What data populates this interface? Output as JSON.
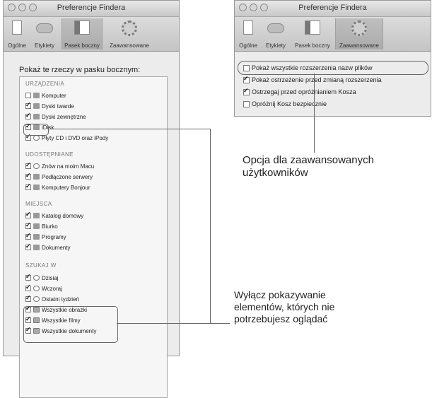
{
  "left_window": {
    "title": "Preferencje Findera",
    "toolbar": [
      "Ogólne",
      "Etykiety",
      "Pasek boczny",
      "Zaawansowane"
    ],
    "selected_tab": "Pasek boczny",
    "heading": "Pokaż te rzeczy w pasku bocznym:",
    "sections": [
      {
        "name": "URZĄDZENIA",
        "items": [
          {
            "label": "Komputer",
            "checked": false
          },
          {
            "label": "Dyski twarde",
            "checked": true
          },
          {
            "label": "Dyski zewnętrzne",
            "checked": true
          },
          {
            "label": "iDisk",
            "checked": true
          },
          {
            "label": "Płyty CD i DVD oraz iPody",
            "checked": true
          }
        ]
      },
      {
        "name": "UDOSTĘPNIANE",
        "items": [
          {
            "label": "Znów na moim Macu",
            "checked": true
          },
          {
            "label": "Podłączone serwery",
            "checked": true
          },
          {
            "label": "Komputery Bonjour",
            "checked": true
          }
        ]
      },
      {
        "name": "MIEJSCA",
        "items": [
          {
            "label": "Katalog domowy",
            "checked": true
          },
          {
            "label": "Biurko",
            "checked": true
          },
          {
            "label": "Programy",
            "checked": true
          },
          {
            "label": "Dokumenty",
            "checked": true
          }
        ]
      },
      {
        "name": "SZUKAJ W",
        "items": [
          {
            "label": "Dzisiaj",
            "checked": true
          },
          {
            "label": "Wczoraj",
            "checked": true
          },
          {
            "label": "Ostatni tydzień",
            "checked": true
          },
          {
            "label": "Wszystkie obrazki",
            "checked": true
          },
          {
            "label": "Wszystkie filmy",
            "checked": true
          },
          {
            "label": "Wszystkie dokumenty",
            "checked": true
          }
        ]
      }
    ]
  },
  "right_window": {
    "title": "Preferencje Findera",
    "toolbar": [
      "Ogólne",
      "Etykiety",
      "Pasek boczny",
      "Zaawansowane"
    ],
    "selected_tab": "Zaawansowane",
    "options": [
      {
        "label": "Pokaż wszystkie rozszerzenia nazw plików",
        "checked": false
      },
      {
        "label": "Pokaż ostrzeżenie przed zmianą rozszerzenia",
        "checked": true
      },
      {
        "label": "Ostrzegaj przed opróżnianiem Kosza",
        "checked": true
      },
      {
        "label": "Opróżnij Kosz bezpiecznie",
        "checked": false
      }
    ]
  },
  "callouts": {
    "advanced": [
      "Opcja dla zaawansowanych",
      "użytkowników"
    ],
    "hide": [
      "Wyłącz pokazywanie",
      "elementów, których nie",
      "potrzebujesz oglądać"
    ]
  }
}
